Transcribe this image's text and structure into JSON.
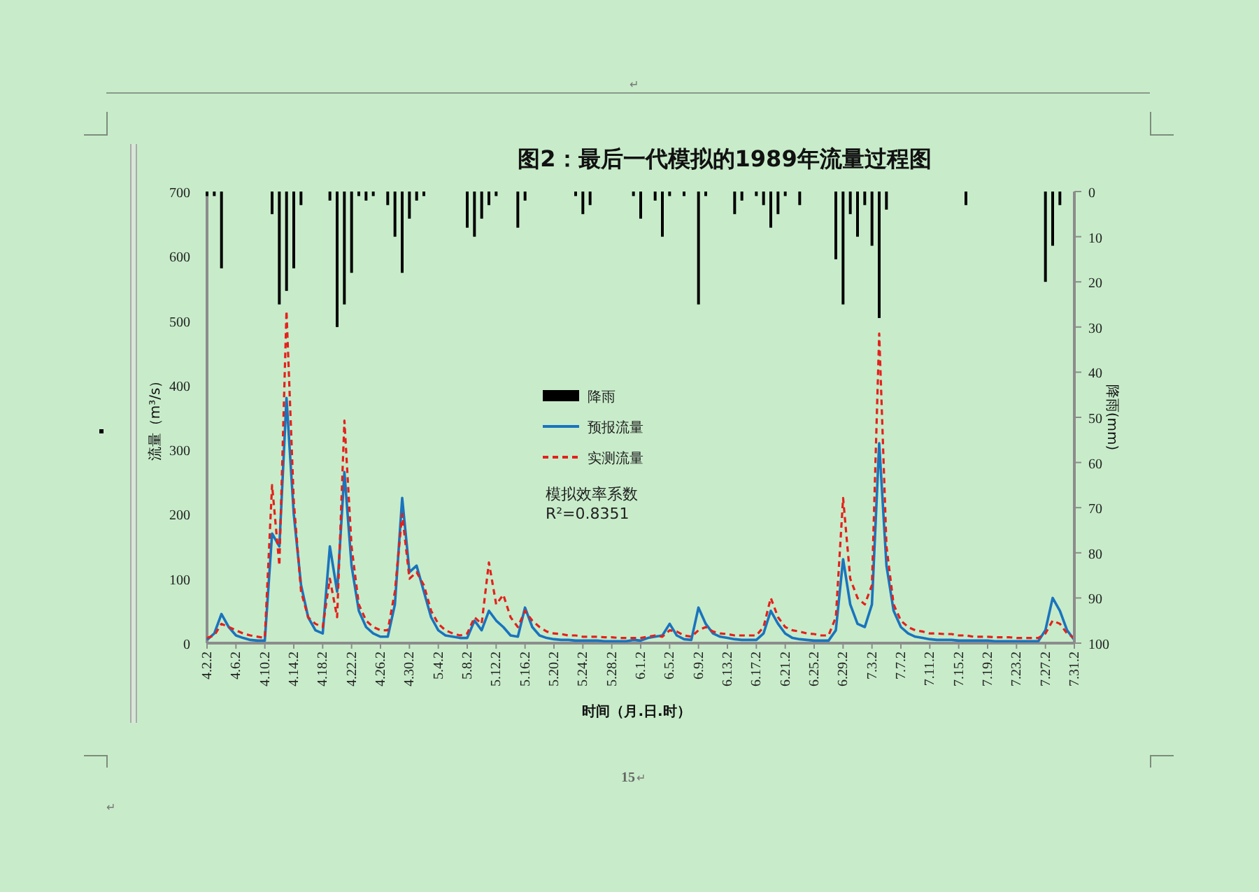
{
  "header": {
    "mark": "↵"
  },
  "figure": {
    "chart_data": {
      "type": "line",
      "title": "图2：最后一代模拟的1989年流量过程图",
      "xlabel": "时间（月.日.时）",
      "ylabel": "流量（m³/s）",
      "categories": [
        "4.2.2",
        null,
        null,
        null,
        "4.6.2",
        null,
        null,
        null,
        "4.10.2",
        null,
        null,
        null,
        "4.14.2",
        null,
        null,
        null,
        "4.18.2",
        null,
        null,
        null,
        "4.22.2",
        null,
        null,
        null,
        "4.26.2",
        null,
        null,
        null,
        "4.30.2",
        null,
        null,
        null,
        "5.4.2",
        null,
        null,
        null,
        "5.8.2",
        null,
        null,
        null,
        "5.12.2",
        null,
        null,
        null,
        "5.16.2",
        null,
        null,
        null,
        "5.20.2",
        null,
        null,
        null,
        "5.24.2",
        null,
        null,
        null,
        "5.28.2",
        null,
        null,
        null,
        "6.1.2",
        null,
        null,
        null,
        "6.5.2",
        null,
        null,
        null,
        "6.9.2",
        null,
        null,
        null,
        "6.13.2",
        null,
        null,
        null,
        "6.17.2",
        null,
        null,
        null,
        "6.21.2",
        null,
        null,
        null,
        "6.25.2",
        null,
        null,
        null,
        "6.29.2",
        null,
        null,
        null,
        "7.3.2",
        null,
        null,
        null,
        "7.7.2",
        null,
        null,
        null,
        "7.11.2",
        null,
        null,
        null,
        "7.15.2",
        null,
        null,
        null,
        "7.19.2",
        null,
        null,
        null,
        "7.23.2",
        null,
        null,
        null,
        "7.27.2",
        null,
        null,
        null,
        "7.31.2"
      ],
      "series": [
        {
          "name": "预报流量",
          "color": "#1a74bd",
          "line_style": "solid",
          "values": [
            5,
            15,
            45,
            25,
            12,
            8,
            5,
            4,
            4,
            170,
            150,
            380,
            200,
            90,
            40,
            20,
            15,
            150,
            80,
            265,
            120,
            50,
            25,
            15,
            10,
            10,
            60,
            225,
            110,
            120,
            80,
            40,
            20,
            12,
            10,
            8,
            8,
            35,
            20,
            50,
            35,
            25,
            12,
            10,
            55,
            25,
            12,
            8,
            6,
            5,
            5,
            4,
            4,
            4,
            4,
            3,
            3,
            3,
            3,
            5,
            4,
            8,
            10,
            12,
            30,
            12,
            6,
            5,
            55,
            30,
            15,
            10,
            8,
            6,
            5,
            5,
            5,
            15,
            50,
            30,
            15,
            8,
            6,
            5,
            4,
            4,
            4,
            20,
            130,
            60,
            30,
            25,
            60,
            310,
            120,
            50,
            25,
            15,
            10,
            8,
            6,
            5,
            5,
            5,
            4,
            4,
            4,
            4,
            4,
            3,
            3,
            3,
            3,
            3,
            3,
            3,
            20,
            70,
            50,
            20,
            5
          ]
        },
        {
          "name": "实测流量",
          "color": "#e4211c",
          "line_style": "dashed",
          "values": [
            8,
            12,
            30,
            25,
            20,
            15,
            12,
            10,
            8,
            245,
            120,
            515,
            220,
            80,
            40,
            30,
            25,
            100,
            40,
            345,
            150,
            60,
            35,
            25,
            20,
            20,
            80,
            200,
            100,
            110,
            90,
            50,
            30,
            20,
            15,
            12,
            15,
            40,
            30,
            125,
            60,
            75,
            40,
            25,
            50,
            35,
            25,
            18,
            15,
            14,
            12,
            12,
            10,
            10,
            10,
            9,
            9,
            8,
            8,
            8,
            8,
            10,
            12,
            10,
            20,
            18,
            12,
            10,
            20,
            25,
            18,
            15,
            14,
            12,
            12,
            12,
            12,
            25,
            70,
            40,
            25,
            20,
            18,
            15,
            14,
            12,
            12,
            40,
            225,
            100,
            70,
            60,
            90,
            480,
            150,
            60,
            35,
            25,
            20,
            18,
            15,
            15,
            14,
            14,
            12,
            12,
            10,
            10,
            10,
            9,
            9,
            9,
            8,
            8,
            8,
            8,
            15,
            35,
            30,
            15,
            8
          ]
        }
      ],
      "legend": true,
      "ylim": [
        0,
        700
      ],
      "yticks": [
        0,
        100,
        200,
        300,
        400,
        500,
        600,
        700
      ],
      "annotations": [
        {
          "text": "模拟效率系数"
        },
        {
          "text": "R²=0.8351"
        }
      ]
    },
    "rainfall": {
      "chart_data": {
        "type": "bar",
        "ylabel": "降雨(mm)",
        "ylim": [
          100,
          0
        ],
        "yticks": [
          0,
          10,
          20,
          30,
          40,
          50,
          60,
          70,
          80,
          90,
          100
        ],
        "categories": [
          null,
          null,
          null,
          null,
          null,
          null,
          null,
          null,
          null,
          null,
          null,
          null,
          null,
          null,
          null,
          null,
          null,
          null,
          null,
          null,
          null,
          null,
          null,
          null,
          null,
          null,
          null,
          null,
          null,
          null,
          null,
          null,
          null,
          null,
          null,
          null,
          null,
          null,
          null,
          null,
          null,
          null,
          null,
          null,
          null,
          null,
          null,
          null,
          null,
          null,
          null,
          null,
          null,
          null,
          null,
          null,
          null,
          null,
          null,
          null,
          null,
          null,
          null,
          null,
          null,
          null,
          null,
          null,
          null,
          null,
          null,
          null,
          null,
          null,
          null,
          null,
          null,
          null,
          null,
          null,
          null,
          null,
          null,
          null,
          null,
          null,
          null,
          null,
          null,
          null,
          null,
          null,
          null,
          null,
          null,
          null,
          null,
          null,
          null,
          null,
          null,
          null,
          null,
          null,
          null,
          null,
          null,
          null,
          null,
          null,
          null,
          null,
          null,
          null,
          null,
          null,
          null,
          null,
          null,
          null,
          null
        ],
        "series": [
          {
            "name": "降雨",
            "color": "#000000",
            "values": [
              1,
              1,
              17,
              0,
              0,
              0,
              0,
              0,
              0,
              5,
              25,
              22,
              17,
              3,
              0,
              0,
              0,
              2,
              30,
              25,
              18,
              1,
              2,
              1,
              0,
              3,
              10,
              18,
              6,
              2,
              1,
              0,
              0,
              0,
              0,
              0,
              8,
              10,
              6,
              3,
              1,
              0,
              0,
              8,
              2,
              0,
              0,
              0,
              0,
              0,
              0,
              1,
              5,
              3,
              0,
              0,
              0,
              0,
              0,
              1,
              6,
              0,
              2,
              10,
              1,
              0,
              1,
              0,
              25,
              1,
              0,
              0,
              0,
              5,
              2,
              0,
              1,
              3,
              8,
              5,
              1,
              0,
              3,
              0,
              0,
              0,
              0,
              15,
              25,
              5,
              10,
              3,
              12,
              28,
              4,
              0,
              0,
              0,
              0,
              0,
              0,
              0,
              0,
              0,
              0,
              3,
              0,
              0,
              0,
              0,
              0,
              0,
              0,
              0,
              0,
              0,
              20,
              12,
              3,
              0,
              0
            ]
          }
        ]
      }
    }
  },
  "footer": {
    "page_number": "15",
    "mark": "↵",
    "corner_mark": "↵"
  }
}
